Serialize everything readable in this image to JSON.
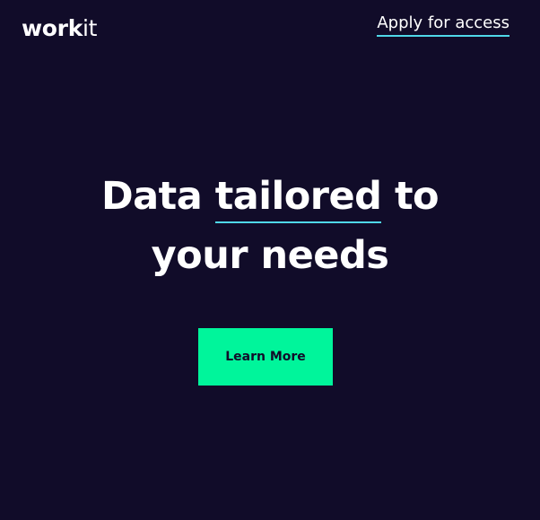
{
  "header": {
    "logo_bold": "work",
    "logo_light": "it",
    "apply_link": "Apply for access"
  },
  "hero": {
    "headline_before": "Data ",
    "headline_accent": "tailored",
    "headline_after": " to",
    "headline_line2": "your needs"
  },
  "cta": {
    "label": "Learn More"
  },
  "colors": {
    "background": "#110c29",
    "text": "#ffffff",
    "accent_underline": "#4fd8e8",
    "button": "#00f59b",
    "button_text": "#110c29"
  }
}
